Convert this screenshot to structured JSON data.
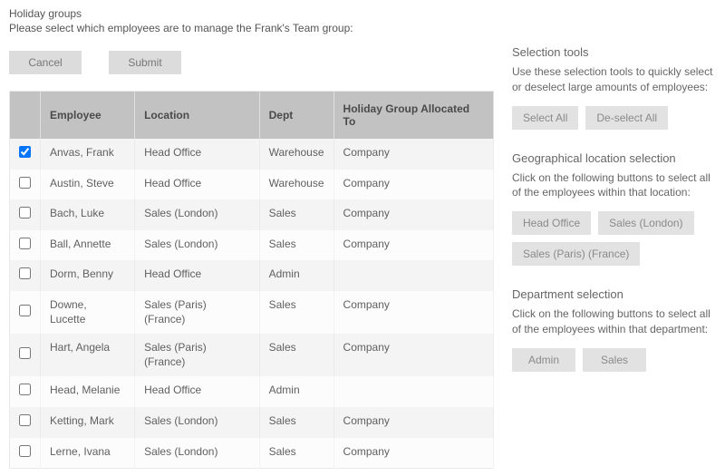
{
  "header": {
    "title": "Holiday groups",
    "subtitle": "Please select which employees are to manage the Frank's Team group:"
  },
  "actions": {
    "cancel": "Cancel",
    "submit": "Submit"
  },
  "table": {
    "columns": {
      "employee": "Employee",
      "location": "Location",
      "dept": "Dept",
      "holiday_group": "Holiday Group Allocated To"
    },
    "rows": [
      {
        "checked": true,
        "employee": "Anvas, Frank",
        "location": "Head Office",
        "dept": "Warehouse",
        "holiday_group": "Company"
      },
      {
        "checked": false,
        "employee": "Austin, Steve",
        "location": "Head Office",
        "dept": "Warehouse",
        "holiday_group": "Company"
      },
      {
        "checked": false,
        "employee": "Bach, Luke",
        "location": "Sales (London)",
        "dept": "Sales",
        "holiday_group": "Company"
      },
      {
        "checked": false,
        "employee": "Ball, Annette",
        "location": "Sales (London)",
        "dept": "Sales",
        "holiday_group": "Company"
      },
      {
        "checked": false,
        "employee": "Dorm, Benny",
        "location": "Head Office",
        "dept": "Admin",
        "holiday_group": ""
      },
      {
        "checked": false,
        "employee": "Downe, Lucette",
        "location": "Sales (Paris) (France)",
        "dept": "Sales",
        "holiday_group": "Company"
      },
      {
        "checked": false,
        "employee": "Hart, Angela",
        "location": "Sales (Paris) (France)",
        "dept": "Sales",
        "holiday_group": "Company"
      },
      {
        "checked": false,
        "employee": "Head, Melanie",
        "location": "Head Office",
        "dept": "Admin",
        "holiday_group": ""
      },
      {
        "checked": false,
        "employee": "Ketting, Mark",
        "location": "Sales (London)",
        "dept": "Sales",
        "holiday_group": "Company"
      },
      {
        "checked": false,
        "employee": "Lerne, Ivana",
        "location": "Sales (London)",
        "dept": "Sales",
        "holiday_group": "Company"
      }
    ]
  },
  "side": {
    "selection_tools": {
      "title": "Selection tools",
      "text": "Use these selection tools to quickly select or deselect large amounts of employees:",
      "select_all": "Select All",
      "deselect_all": "De-select All"
    },
    "location_section": {
      "title": "Geographical location selection",
      "text": "Click on the following buttons to select all of the employees within that location:",
      "buttons": [
        "Head Office",
        "Sales (London)",
        "Sales (Paris) (France)"
      ]
    },
    "dept_section": {
      "title": "Department selection",
      "text": "Click on the following buttons to select all of the employees within that department:",
      "buttons": [
        "Admin",
        "Sales"
      ]
    }
  }
}
